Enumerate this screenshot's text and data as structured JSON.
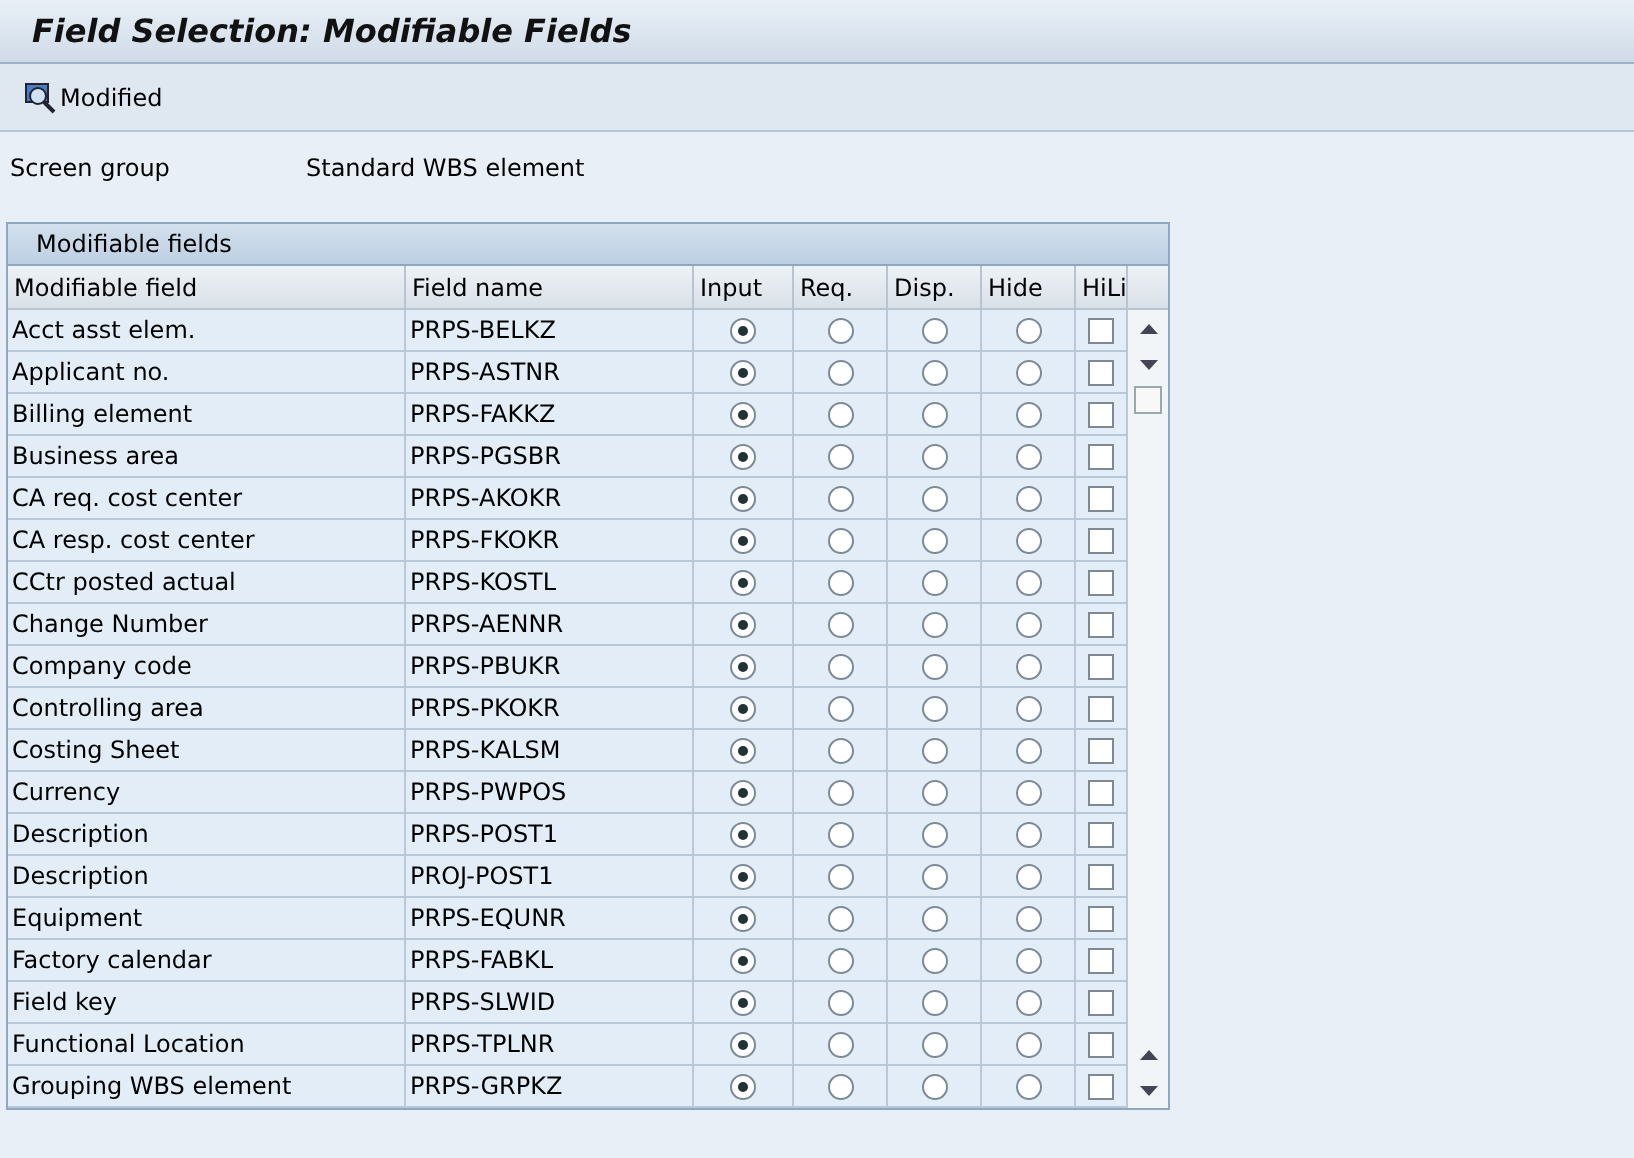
{
  "window": {
    "title": "Field Selection: Modifiable Fields"
  },
  "toolbar": {
    "buttons": [
      {
        "label": "Modified"
      }
    ]
  },
  "screen_group": {
    "label": "Screen group",
    "value": "Standard WBS element"
  },
  "table": {
    "title": "Modifiable fields",
    "columns": [
      "Modifiable field",
      "Field name",
      "Input",
      "Req.",
      "Disp.",
      "Hide",
      "HiLi"
    ],
    "rows": [
      {
        "field": "Acct asst elem.",
        "name": "PRPS-BELKZ",
        "input": true,
        "req": false,
        "disp": false,
        "hide": false,
        "hili": false
      },
      {
        "field": "Applicant no.",
        "name": "PRPS-ASTNR",
        "input": true,
        "req": false,
        "disp": false,
        "hide": false,
        "hili": false
      },
      {
        "field": "Billing element",
        "name": "PRPS-FAKKZ",
        "input": true,
        "req": false,
        "disp": false,
        "hide": false,
        "hili": false
      },
      {
        "field": "Business area",
        "name": "PRPS-PGSBR",
        "input": true,
        "req": false,
        "disp": false,
        "hide": false,
        "hili": false
      },
      {
        "field": "CA req. cost center",
        "name": "PRPS-AKOKR",
        "input": true,
        "req": false,
        "disp": false,
        "hide": false,
        "hili": false
      },
      {
        "field": "CA resp. cost center",
        "name": "PRPS-FKOKR",
        "input": true,
        "req": false,
        "disp": false,
        "hide": false,
        "hili": false
      },
      {
        "field": "CCtr posted actual",
        "name": "PRPS-KOSTL",
        "input": true,
        "req": false,
        "disp": false,
        "hide": false,
        "hili": false
      },
      {
        "field": "Change Number",
        "name": "PRPS-AENNR",
        "input": true,
        "req": false,
        "disp": false,
        "hide": false,
        "hili": false
      },
      {
        "field": "Company code",
        "name": "PRPS-PBUKR",
        "input": true,
        "req": false,
        "disp": false,
        "hide": false,
        "hili": false
      },
      {
        "field": "Controlling area",
        "name": "PRPS-PKOKR",
        "input": true,
        "req": false,
        "disp": false,
        "hide": false,
        "hili": false
      },
      {
        "field": "Costing Sheet",
        "name": "PRPS-KALSM",
        "input": true,
        "req": false,
        "disp": false,
        "hide": false,
        "hili": false
      },
      {
        "field": "Currency",
        "name": "PRPS-PWPOS",
        "input": true,
        "req": false,
        "disp": false,
        "hide": false,
        "hili": false
      },
      {
        "field": "Description",
        "name": "PRPS-POST1",
        "input": true,
        "req": false,
        "disp": false,
        "hide": false,
        "hili": false
      },
      {
        "field": "Description",
        "name": "PROJ-POST1",
        "input": true,
        "req": false,
        "disp": false,
        "hide": false,
        "hili": false
      },
      {
        "field": "Equipment",
        "name": "PRPS-EQUNR",
        "input": true,
        "req": false,
        "disp": false,
        "hide": false,
        "hili": false
      },
      {
        "field": "Factory calendar",
        "name": "PRPS-FABKL",
        "input": true,
        "req": false,
        "disp": false,
        "hide": false,
        "hili": false
      },
      {
        "field": "Field key",
        "name": "PRPS-SLWID",
        "input": true,
        "req": false,
        "disp": false,
        "hide": false,
        "hili": false
      },
      {
        "field": "Functional Location",
        "name": "PRPS-TPLNR",
        "input": true,
        "req": false,
        "disp": false,
        "hide": false,
        "hili": false
      },
      {
        "field": "Grouping WBS element",
        "name": "PRPS-GRPKZ",
        "input": true,
        "req": false,
        "disp": false,
        "hide": false,
        "hili": false
      }
    ]
  }
}
